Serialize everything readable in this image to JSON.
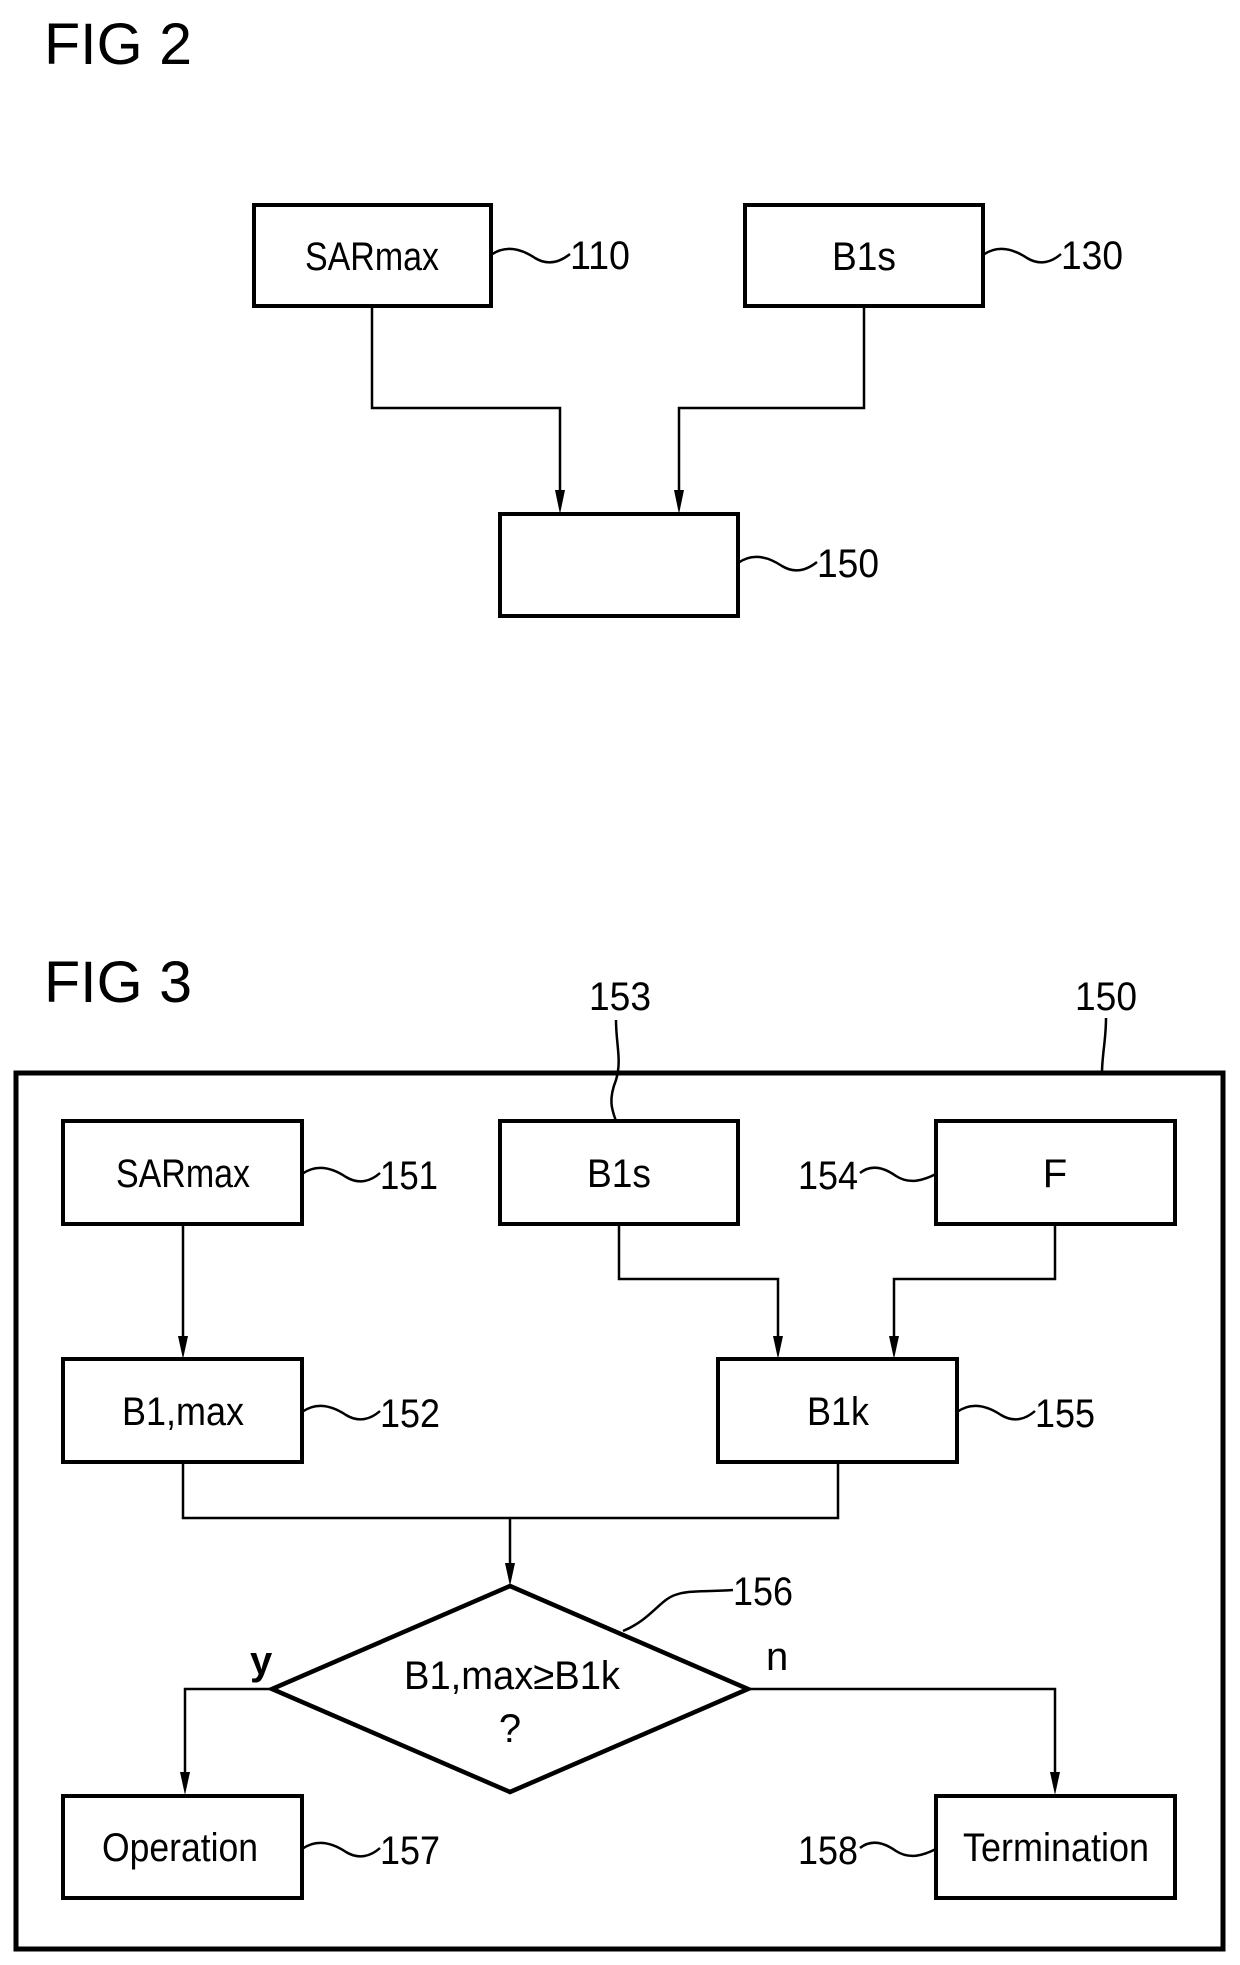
{
  "fig2": {
    "title": "FIG 2",
    "blocks": [
      {
        "id": "110",
        "label": "SARmax"
      },
      {
        "id": "130",
        "label": "B1s"
      },
      {
        "id": "150",
        "label": ""
      }
    ],
    "refs": {
      "sarmax": "110",
      "b1s": "130",
      "unit": "150"
    }
  },
  "fig3": {
    "title": "FIG 3",
    "container_ref": "150",
    "blocks": {
      "sarmax": {
        "ref": "151",
        "label": "SARmax"
      },
      "b1max": {
        "ref": "152",
        "label": "B1,max"
      },
      "b1s": {
        "ref": "153",
        "label": "B1s"
      },
      "f": {
        "ref": "154",
        "label": "F"
      },
      "b1k": {
        "ref": "155",
        "label": "B1k"
      },
      "decision": {
        "ref": "156",
        "line1": "B1,max≥B1k",
        "line2": "?"
      },
      "operation": {
        "ref": "157",
        "label": "Operation"
      },
      "termination": {
        "ref": "158",
        "label": "Termination"
      }
    },
    "branches": {
      "yes": "y",
      "no": "n"
    }
  }
}
